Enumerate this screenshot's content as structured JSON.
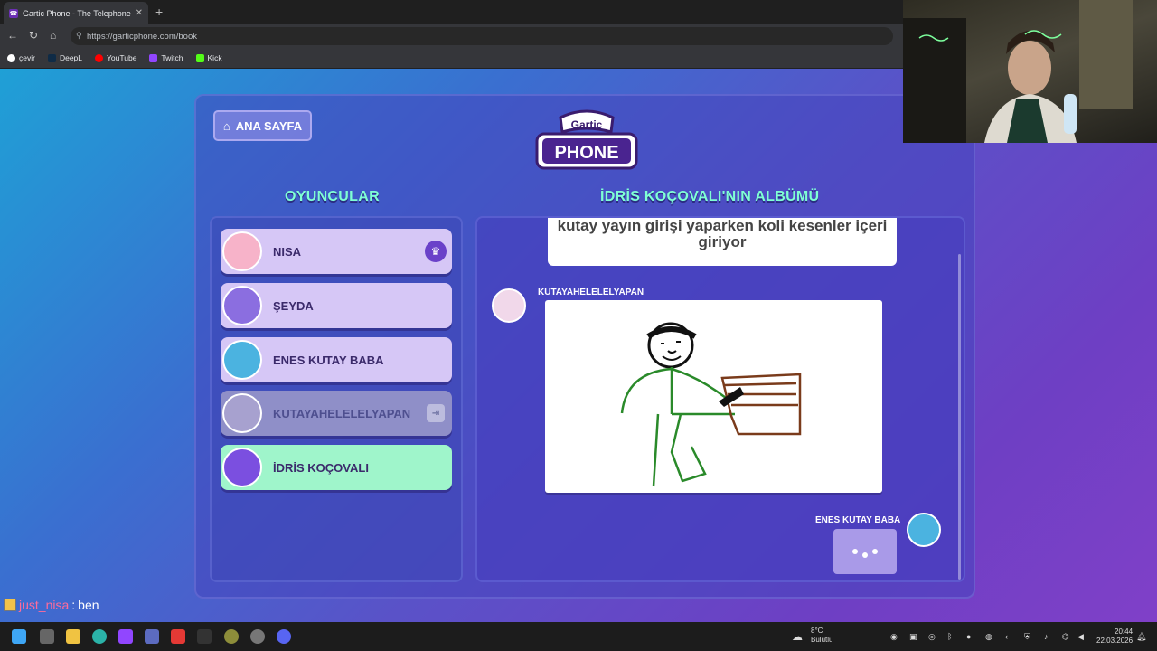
{
  "browser": {
    "tab_title": "Gartic Phone - The Telephone Game",
    "url": "https://garticphone.com/book",
    "bookmarks": [
      {
        "label": "çevir",
        "color": "#ffffff"
      },
      {
        "label": "DeepL",
        "color": "#0f2b46"
      },
      {
        "label": "YouTube",
        "color": "#ff0000"
      },
      {
        "label": "Twitch",
        "color": "#9146ff"
      },
      {
        "label": "Kick",
        "color": "#53fc18"
      }
    ]
  },
  "game": {
    "home_button": "ANA SAYFA",
    "logo_top": "Gartic",
    "logo_bottom": "PHONE",
    "players_heading": "OYUNCULAR",
    "album_heading": "İDRİS KOÇOVALI'NIN ALBÜMÜ",
    "players": [
      {
        "name": "NISA",
        "state": "host"
      },
      {
        "name": "ŞEYDA",
        "state": "normal"
      },
      {
        "name": "ENES KUTAY BABA",
        "state": "normal"
      },
      {
        "name": "KUTAYAHELELELYAPAN",
        "state": "left"
      },
      {
        "name": "İDRİS KOÇOVALI",
        "state": "current"
      }
    ],
    "album": {
      "caption": "kutay yayın girişi yaparken koli kesenler içeri giriyor",
      "drawing_author": "KUTAYAHELELELYAPAN",
      "next_author": "ENES KUTAY BABA"
    }
  },
  "chat": {
    "username": "just_nisa",
    "separator": ":",
    "message": "ben"
  },
  "taskbar": {
    "weather_temp": "8°C",
    "weather_desc": "Bulutlu",
    "time": "20:44",
    "date": "22.03.2026"
  }
}
